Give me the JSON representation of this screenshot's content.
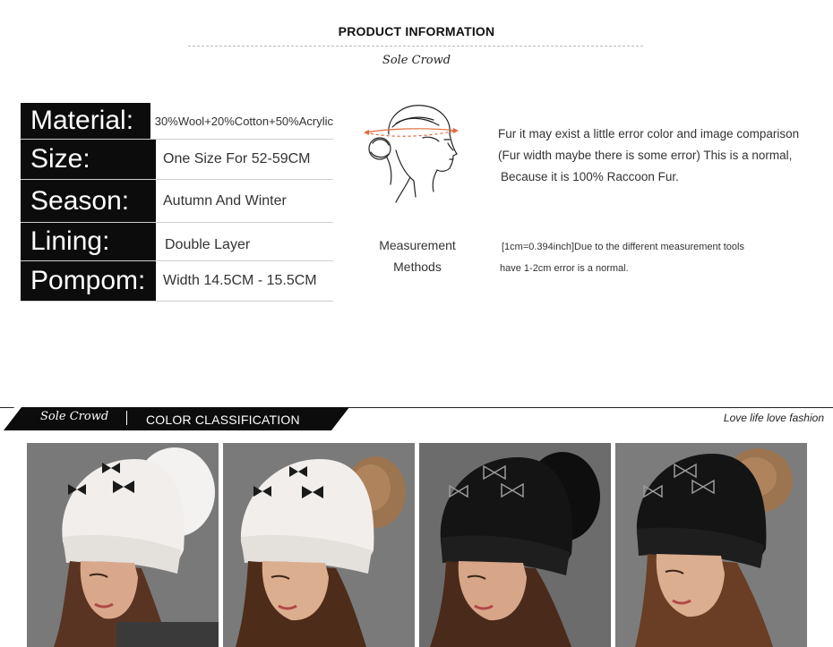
{
  "header": {
    "title": "PRODUCT INFORMATION",
    "brand": "Sole Crowd"
  },
  "specs": [
    {
      "label": "Material:",
      "value": "30%Wool+20%Cotton+50%Acrylic"
    },
    {
      "label": "Size:",
      "value": "One Size For 52-59CM"
    },
    {
      "label": "Season:",
      "value": "Autumn And Winter"
    },
    {
      "label": "Lining:",
      "value": "Double Layer"
    },
    {
      "label": "Pompom:",
      "value": "Width 14.5CM - 15.5CM"
    }
  ],
  "measurement": {
    "label_line1": "Measurement",
    "label_line2": "Methods",
    "fur_note": [
      "Fur it may exist a little error color and image comparison",
      "(Fur width maybe there is some error) This is a normal,",
      "Because it is 100% Raccoon Fur."
    ],
    "conversion_note": [
      "[1cm=0.394inch]Due to the different measurement tools",
      "have 1-2cm error is a normal."
    ]
  },
  "banner": {
    "brand": "Sole Crowd",
    "title": "COLOR CLASSIFICATION",
    "tagline": "Love life  love fashion"
  },
  "colors": {
    "dark": "#0c0c0c",
    "white_hat": "#f1eeeb",
    "black_hat": "#141414",
    "white_pompom": "#f4f2f0",
    "natural_pompom": "#9c7450"
  },
  "photos": [
    {
      "hat": "white",
      "pompom": "white"
    },
    {
      "hat": "white",
      "pompom": "natural"
    },
    {
      "hat": "black",
      "pompom": "black"
    },
    {
      "hat": "black",
      "pompom": "natural"
    }
  ]
}
